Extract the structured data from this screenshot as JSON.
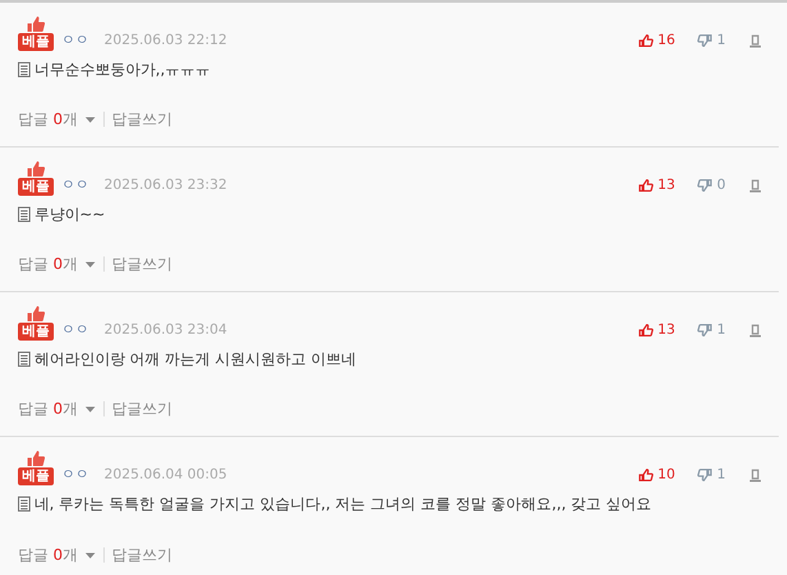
{
  "comments": [
    {
      "badge": "베플",
      "author": "ㅇㅇ",
      "date": "2025.06.03 22:12",
      "likes": "16",
      "dislikes": "1",
      "text": "너무순수뽀둥아가,,ㅠㅠㅠ",
      "reply_label": "답글",
      "reply_count": "0",
      "reply_unit": "개",
      "write_reply": "답글쓰기"
    },
    {
      "badge": "베플",
      "author": "ㅇㅇ",
      "date": "2025.06.03 23:32",
      "likes": "13",
      "dislikes": "0",
      "text": "루냥이~~",
      "reply_label": "답글",
      "reply_count": "0",
      "reply_unit": "개",
      "write_reply": "답글쓰기"
    },
    {
      "badge": "베플",
      "author": "ㅇㅇ",
      "date": "2025.06.03 23:04",
      "likes": "13",
      "dislikes": "1",
      "text": "헤어라인이랑 어깨 까는게 시원시원하고 이쁘네",
      "reply_label": "답글",
      "reply_count": "0",
      "reply_unit": "개",
      "write_reply": "답글쓰기"
    },
    {
      "badge": "베플",
      "author": "ㅇㅇ",
      "date": "2025.06.04 00:05",
      "likes": "10",
      "dislikes": "1",
      "text": "네, 루카는 독특한 얼굴을 가지고 있습니다,, 저는 그녀의 코를 정말 좋아해요,,, 갖고 싶어요",
      "reply_label": "답글",
      "reply_count": "0",
      "reply_unit": "개",
      "write_reply": "답글쓰기"
    }
  ]
}
